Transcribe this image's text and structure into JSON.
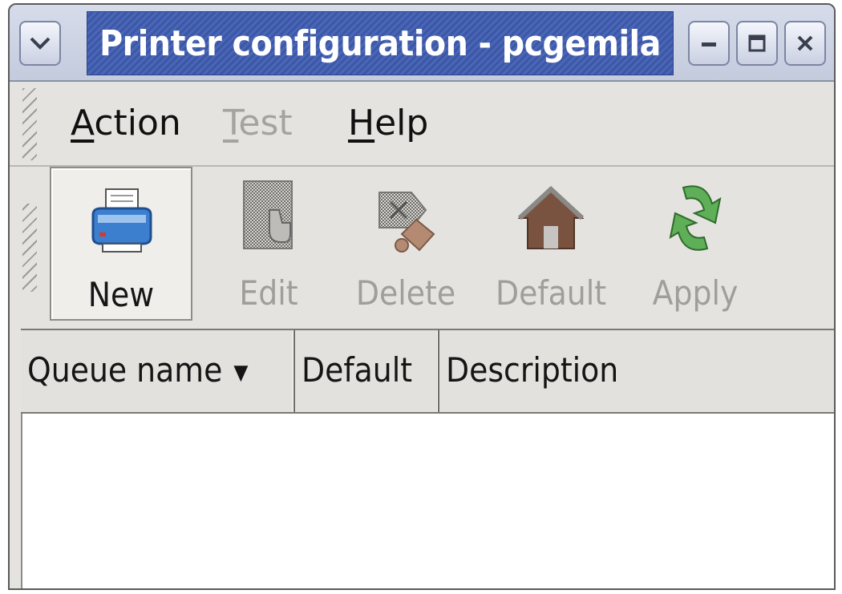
{
  "window": {
    "title": "Printer configuration - pcgemila",
    "buttons": {
      "menu_icon": "chevron-down-icon",
      "minimize_icon": "minimize-icon",
      "maximize_icon": "maximize-icon",
      "close_icon": "close-icon"
    }
  },
  "menubar": {
    "items": [
      {
        "label": "Action",
        "underline": "A",
        "rest": "ction",
        "enabled": true
      },
      {
        "label": "Test",
        "underline": "T",
        "rest": "est",
        "enabled": false
      },
      {
        "label": "Help",
        "underline": "H",
        "rest": "elp",
        "enabled": true
      }
    ]
  },
  "toolbar": {
    "items": [
      {
        "label": "New",
        "icon": "printer-icon",
        "enabled": true,
        "pressed": true
      },
      {
        "label": "Edit",
        "icon": "edit-icon",
        "enabled": false
      },
      {
        "label": "Delete",
        "icon": "delete-icon",
        "enabled": false
      },
      {
        "label": "Default",
        "icon": "home-icon",
        "enabled": false
      },
      {
        "label": "Apply",
        "icon": "apply-icon",
        "enabled": false
      }
    ]
  },
  "table": {
    "columns": [
      {
        "label": "Queue name",
        "sort_icon": "sort-down-icon"
      },
      {
        "label": "Default"
      },
      {
        "label": "Description"
      }
    ],
    "rows": []
  },
  "colors": {
    "title_bar_active": "#4a66b6",
    "window_bg": "#e4e3e0",
    "disabled_text": "#a4a3a0"
  }
}
